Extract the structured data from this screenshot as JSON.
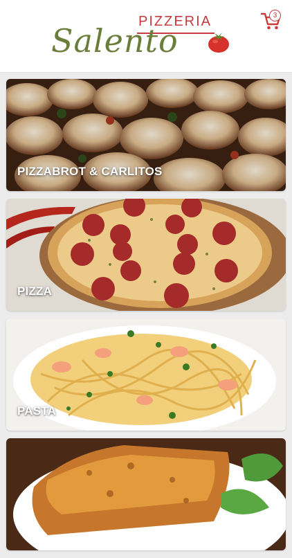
{
  "header": {
    "logo_top": "PIZZERIA",
    "logo_script": "Salento",
    "cart_count": "3"
  },
  "categories": [
    {
      "label": "PIZZABROT & CARLITOS",
      "icon": "pizzabrot-photo"
    },
    {
      "label": "PIZZA",
      "icon": "pizza-photo"
    },
    {
      "label": "PASTA",
      "icon": "pasta-photo"
    },
    {
      "label": "",
      "icon": "lasagne-photo"
    }
  ],
  "colors": {
    "brand_red": "#c9383a",
    "brand_green": "#6b7d3a",
    "background": "#ececec"
  }
}
